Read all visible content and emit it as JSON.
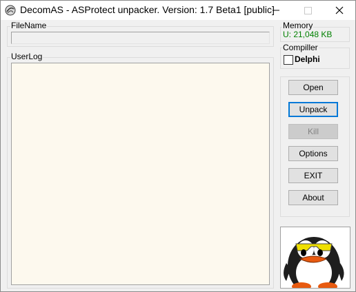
{
  "window": {
    "title": "DecomAS - ASProtect unpacker. Version: 1.7 Beta1 [public]",
    "icon": "decomas-app-icon"
  },
  "filename": {
    "label": "FileName",
    "value": ""
  },
  "userlog": {
    "label": "UserLog",
    "content": ""
  },
  "memory": {
    "label": "Memory",
    "value": "U: 21,048 KB",
    "value_color": "#008000"
  },
  "compiler": {
    "label": "Compiller",
    "option_label": "Delphi",
    "checked": false
  },
  "buttons": {
    "open": "Open",
    "unpack": "Unpack",
    "kill": "Kill",
    "options": "Options",
    "exit": "EXIT",
    "about": "About"
  },
  "mascot": {
    "icon": "penguin-mascot-icon"
  }
}
